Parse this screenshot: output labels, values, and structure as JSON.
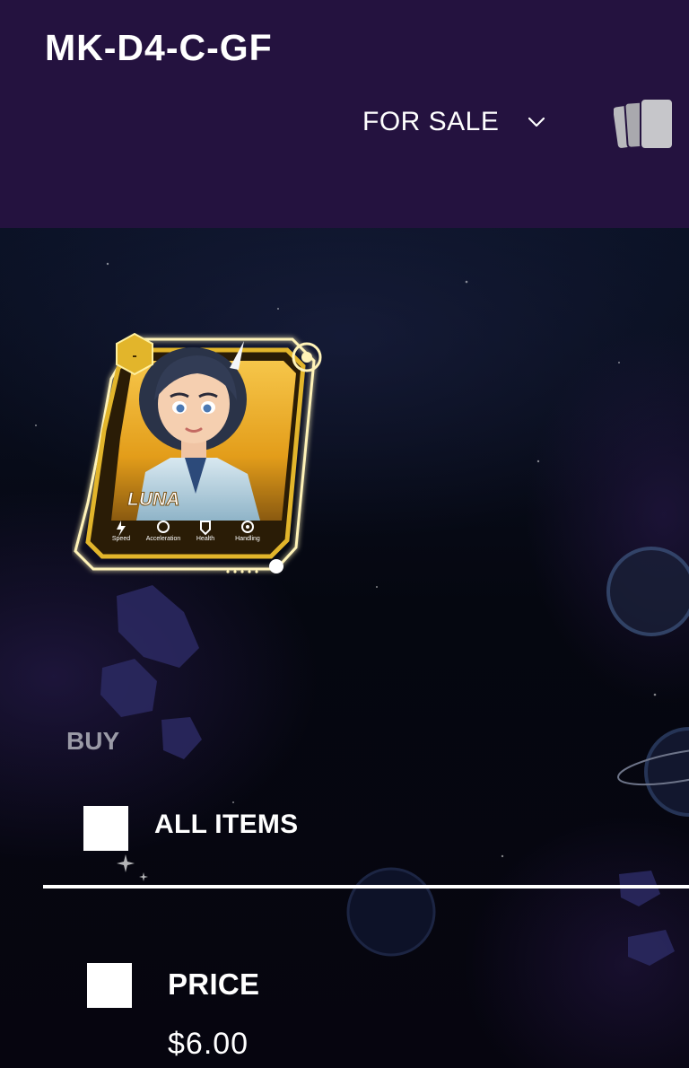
{
  "header": {
    "title": "MK-D4-C-GF",
    "filter_label": "FOR SALE",
    "filter_icon": "chevron-down-icon",
    "cards_icon": "cards-stack-icon"
  },
  "card": {
    "name": "LUNA",
    "level_badge": "-",
    "stats": [
      "Speed",
      "Acceleration",
      "Health",
      "Handling"
    ]
  },
  "filters": {
    "section_label": "BUY",
    "all_items_label": "ALL ITEMS",
    "price_label": "PRICE",
    "price_value": "$6.00"
  },
  "colors": {
    "header_bg": "#24123f",
    "card_gold": "#e2b52b",
    "background": "#05060d"
  }
}
